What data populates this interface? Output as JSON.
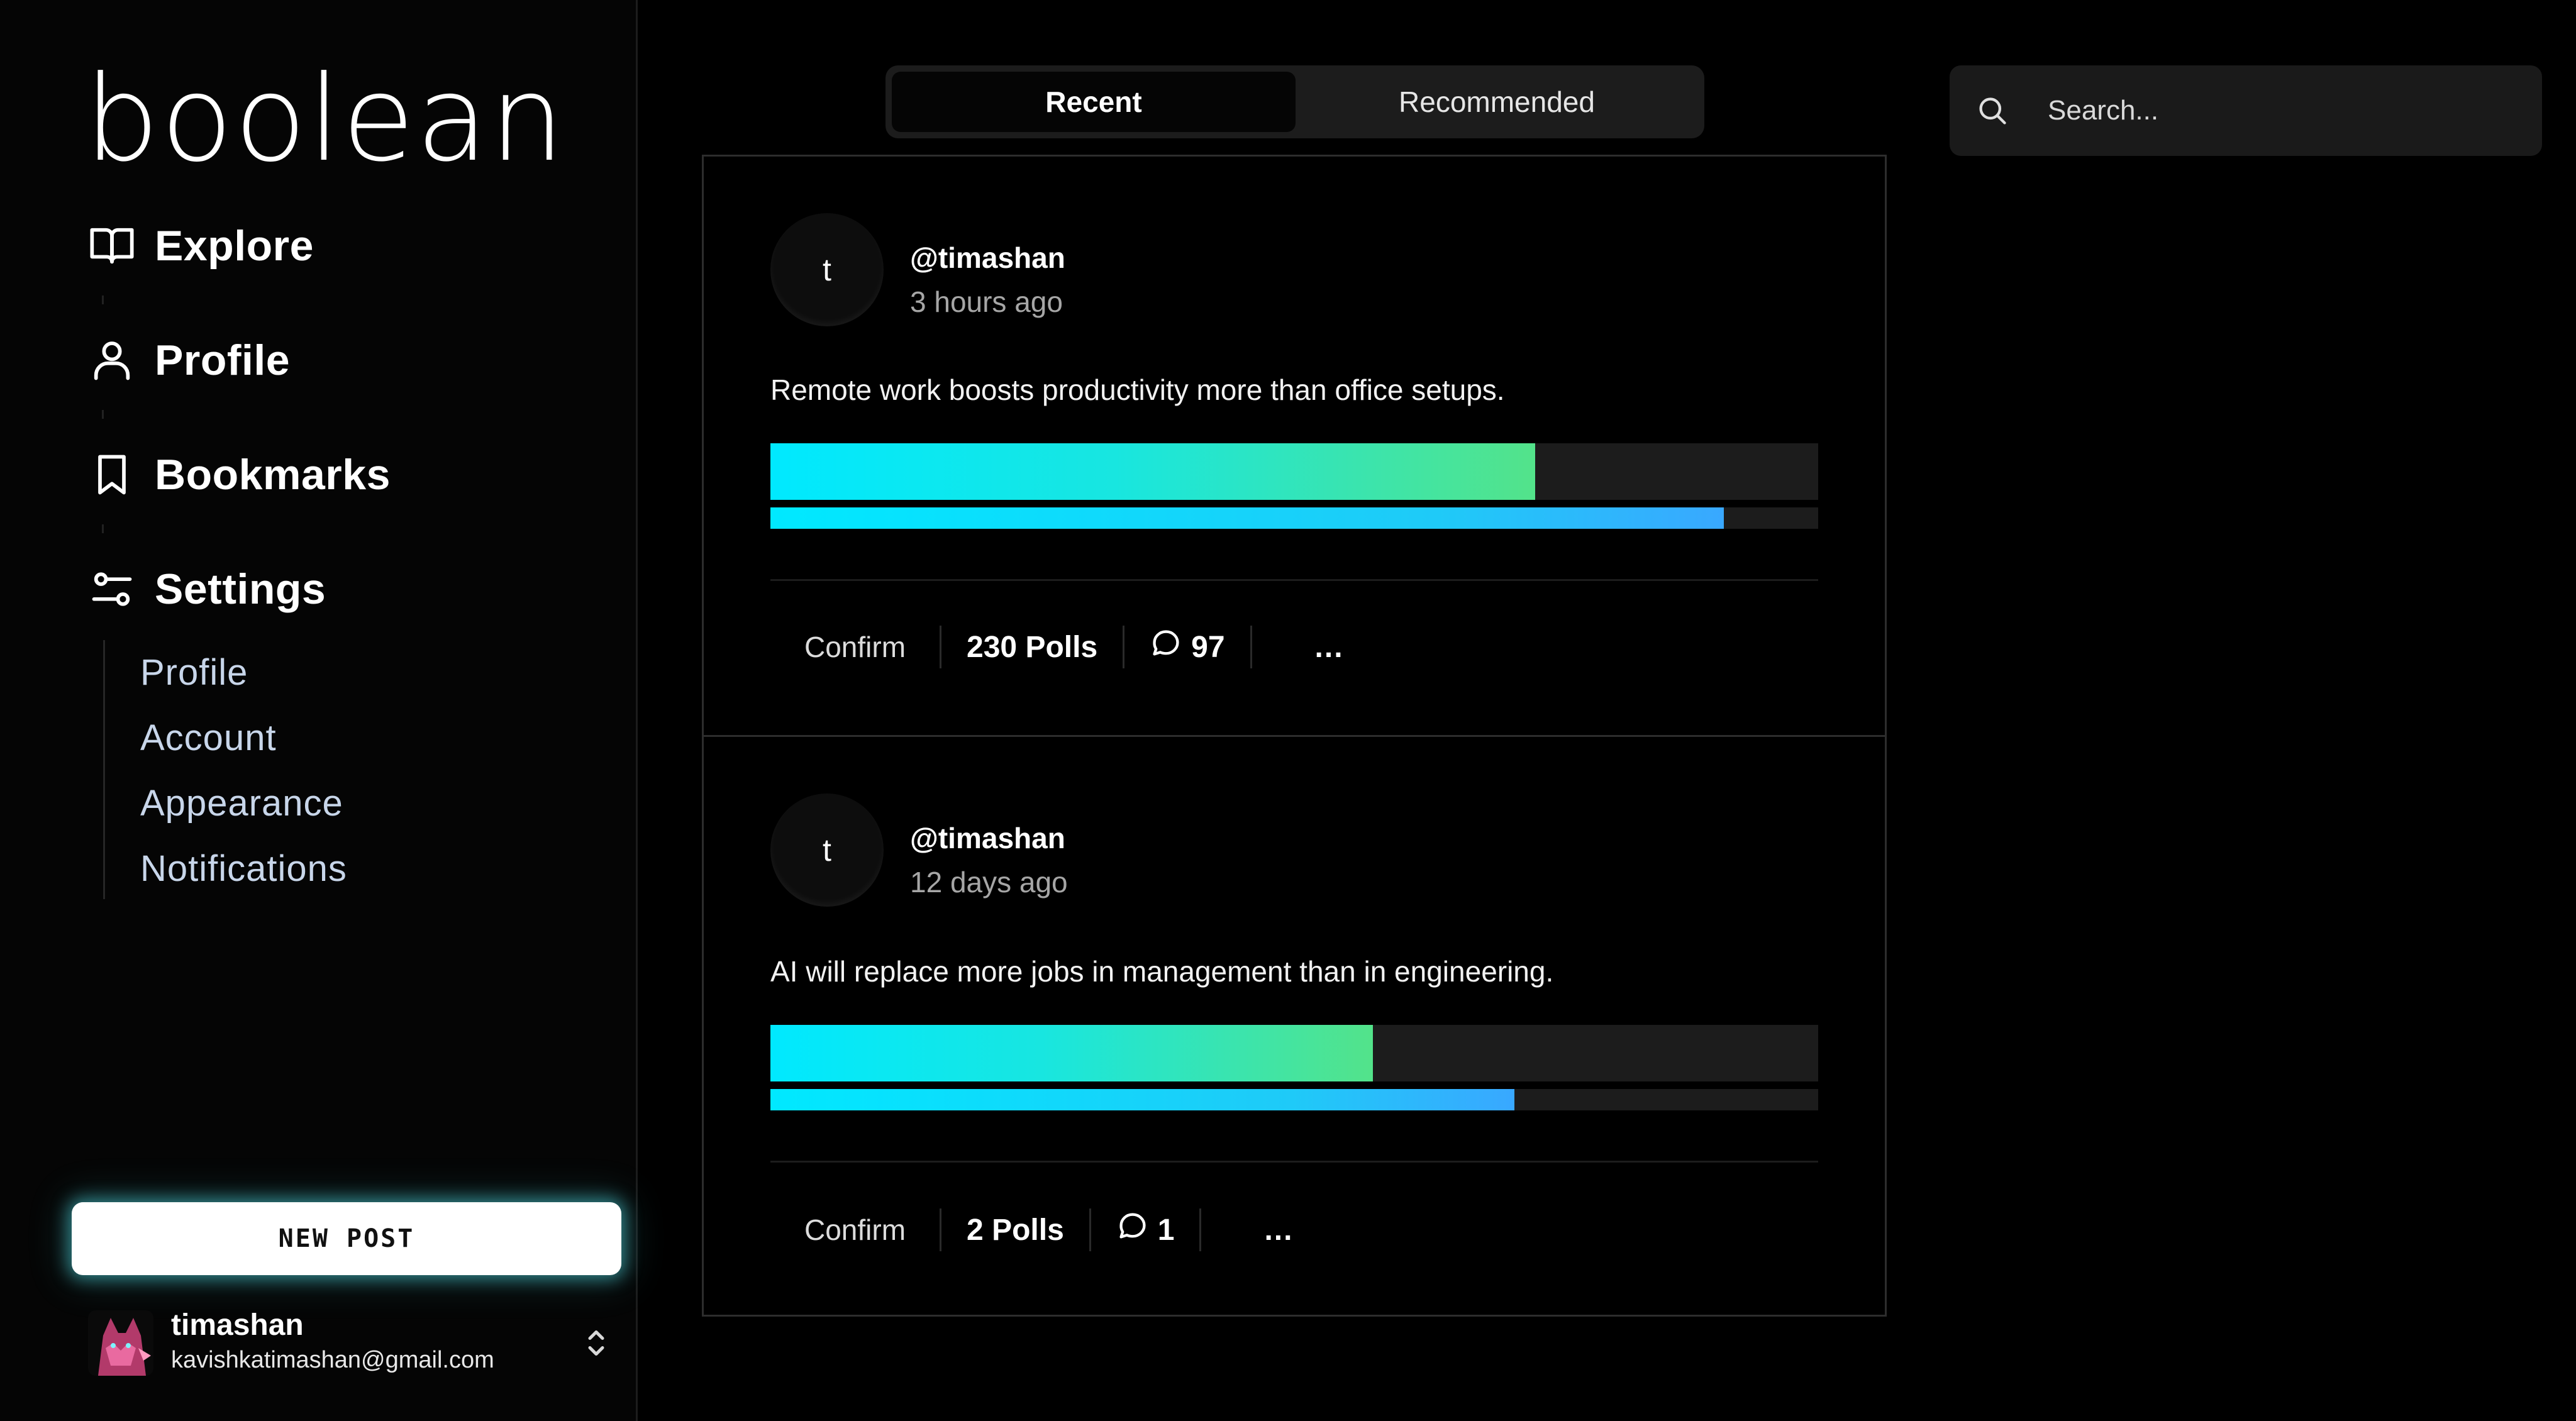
{
  "app": {
    "logo_text": "boolean"
  },
  "sidebar": {
    "nav": [
      {
        "label": "Explore",
        "icon": "book-open-icon"
      },
      {
        "label": "Profile",
        "icon": "user-icon"
      },
      {
        "label": "Bookmarks",
        "icon": "bookmark-icon"
      },
      {
        "label": "Settings",
        "icon": "sliders-icon"
      }
    ],
    "settings_sub": [
      "Profile",
      "Account",
      "Appearance",
      "Notifications"
    ],
    "new_post_label": "NEW POST",
    "user": {
      "name": "timashan",
      "email": "kavishkatimashan@gmail.com"
    }
  },
  "tabs": [
    {
      "label": "Recent",
      "active": true
    },
    {
      "label": "Recommended",
      "active": false
    }
  ],
  "search": {
    "placeholder": "Search..."
  },
  "colors": {
    "background": "#000000",
    "accent_cyan": "#00e9ff",
    "accent_green": "#53e38a",
    "accent_blue": "#39a8ff",
    "new_post_glow": "#4cd6de"
  },
  "posts": [
    {
      "avatar_letter": "t",
      "username": "@timashan",
      "time": "3 hours ago",
      "text": "Remote work boosts productivity more than office setups.",
      "poll_result_primary": 0.73,
      "poll_result_secondary": 0.91,
      "confirm_label": "Confirm",
      "polls_label": "230 Polls",
      "comments_count": "97",
      "more_label": "..."
    },
    {
      "avatar_letter": "t",
      "username": "@timashan",
      "time": "12 days ago",
      "text": "AI will replace more jobs in management than in engineering.",
      "poll_result_primary": 0.575,
      "poll_result_secondary": 0.71,
      "confirm_label": "Confirm",
      "polls_label": "2 Polls",
      "comments_count": "1",
      "more_label": "..."
    }
  ]
}
